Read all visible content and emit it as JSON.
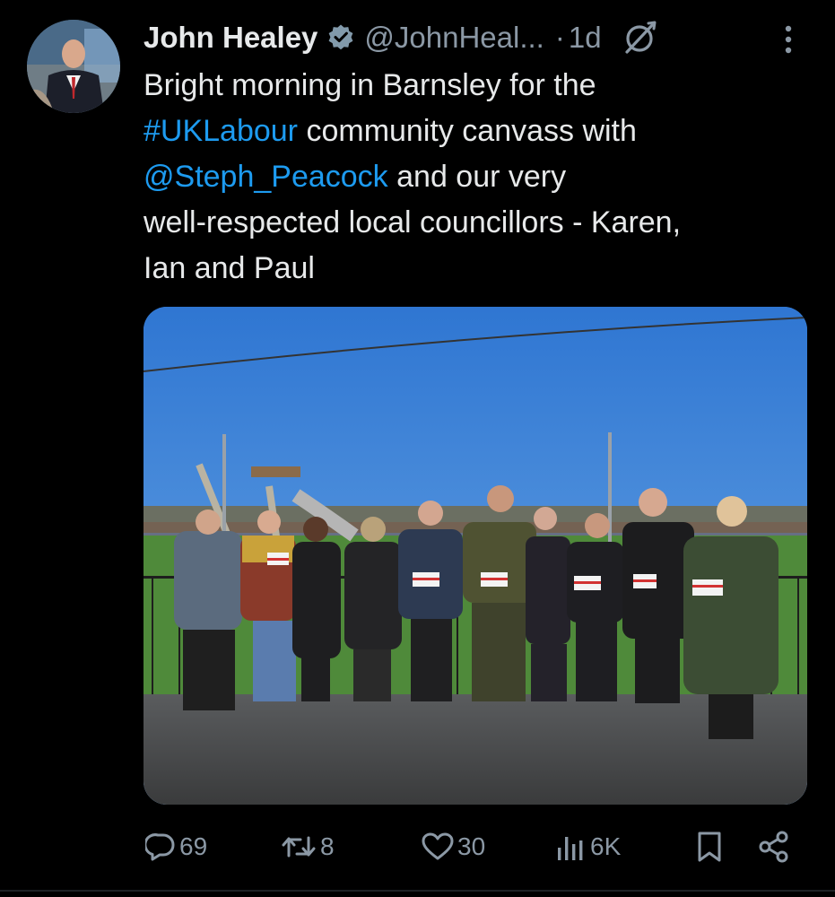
{
  "author": {
    "display_name": "John Healey",
    "handle": "@JohnHeal...",
    "separator": "·",
    "time": "1d",
    "verified": true
  },
  "tweet": {
    "lines": [
      [
        {
          "text": "Bright morning in Barnsley for the",
          "link": false
        }
      ],
      [
        {
          "text": "#UKLabour",
          "link": true
        },
        {
          "text": " community canvass with",
          "link": false
        }
      ],
      [
        {
          "text": "@Steph_Peacock",
          "link": true
        },
        {
          "text": " and our very",
          "link": false
        }
      ],
      [
        {
          "text": "well-respected local councillors - Karen,",
          "link": false
        }
      ],
      [
        {
          "text": "Ian and Paul",
          "link": false
        }
      ]
    ]
  },
  "icons": {
    "verified": "verified-badge-icon",
    "grok": "grok-icon",
    "more": "more-options-icon",
    "reply": "reply-icon",
    "retweet": "retweet-icon",
    "like": "like-icon",
    "views": "views-icon",
    "bookmark": "bookmark-icon",
    "share": "share-icon"
  },
  "actions": {
    "replies": "69",
    "reposts": "8",
    "likes": "30",
    "views": "6K"
  },
  "colors": {
    "background": "#000000",
    "text": "#e7e9ea",
    "secondary": "#8b98a5",
    "link": "#1d9bf0",
    "verified": "#829aab"
  }
}
